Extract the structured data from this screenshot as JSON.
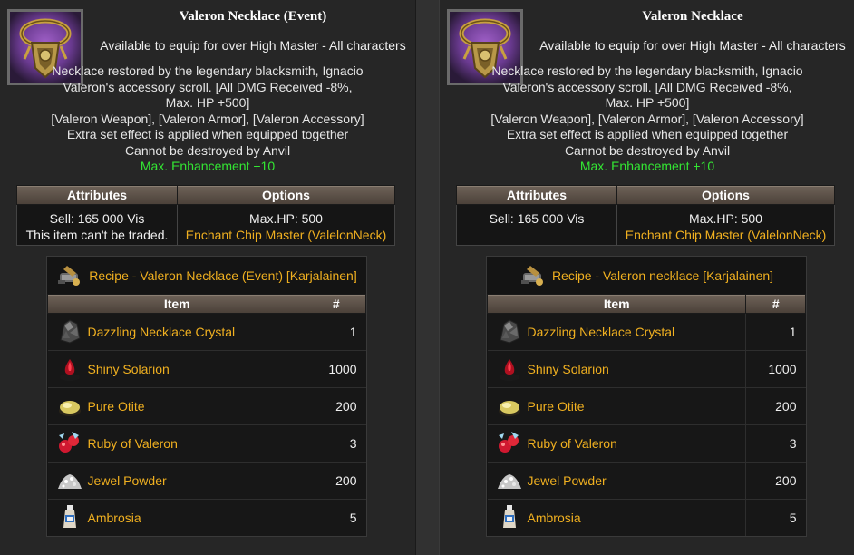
{
  "panels": [
    {
      "title": "Valeron Necklace (Event)",
      "equip": "Available to equip for over High Master - All characters",
      "description": [
        "Necklace restored by the legendary blacksmith, Ignacio",
        "Valeron's accessory scroll. [All DMG Received -8%,",
        "Max. HP +500]",
        "[Valeron Weapon], [Valeron Armor], [Valeron Accessory]",
        "Extra set effect is applied when equipped together",
        "Cannot be destroyed by Anvil"
      ],
      "enhancement": "Max. Enhancement +10",
      "attributes_header": "Attributes",
      "options_header": "Options",
      "sell": "Sell: 165 000 Vis",
      "trade": "This item can't be traded.",
      "option_hp": "Max.HP: 500",
      "enchant": "Enchant Chip Master (ValelonNeck)",
      "recipe_title": "Recipe - Valeron Necklace (Event) [Karjalainen]",
      "item_header": "Item",
      "qty_header": "#",
      "materials": [
        {
          "name": "Dazzling Necklace Crystal",
          "qty": "1",
          "icon": "crystal-icon"
        },
        {
          "name": "Shiny Solarion",
          "qty": "1000",
          "icon": "solarion-icon"
        },
        {
          "name": "Pure Otite",
          "qty": "200",
          "icon": "otite-icon"
        },
        {
          "name": "Ruby of Valeron",
          "qty": "3",
          "icon": "ruby-icon"
        },
        {
          "name": "Jewel Powder",
          "qty": "200",
          "icon": "powder-icon"
        },
        {
          "name": "Ambrosia",
          "qty": "5",
          "icon": "ambrosia-icon"
        }
      ]
    },
    {
      "title": "Valeron Necklace",
      "equip": "Available to equip for over High Master - All characters",
      "description": [
        "Necklace restored by the legendary blacksmith, Ignacio",
        "Valeron's accessory scroll. [All DMG Received -8%,",
        "Max. HP +500]",
        "[Valeron Weapon], [Valeron Armor], [Valeron Accessory]",
        "Extra set effect is applied when equipped together",
        "Cannot be destroyed by Anvil"
      ],
      "enhancement": "Max. Enhancement +10",
      "attributes_header": "Attributes",
      "options_header": "Options",
      "sell": "Sell: 165 000 Vis",
      "trade": "",
      "option_hp": "Max.HP: 500",
      "enchant": "Enchant Chip Master (ValelonNeck)",
      "recipe_title": "Recipe - Valeron necklace [Karjalainen]",
      "item_header": "Item",
      "qty_header": "#",
      "materials": [
        {
          "name": "Dazzling Necklace Crystal",
          "qty": "1",
          "icon": "crystal-icon"
        },
        {
          "name": "Shiny Solarion",
          "qty": "1000",
          "icon": "solarion-icon"
        },
        {
          "name": "Pure Otite",
          "qty": "200",
          "icon": "otite-icon"
        },
        {
          "name": "Ruby of Valeron",
          "qty": "3",
          "icon": "ruby-icon"
        },
        {
          "name": "Jewel Powder",
          "qty": "200",
          "icon": "powder-icon"
        },
        {
          "name": "Ambrosia",
          "qty": "5",
          "icon": "ambrosia-icon"
        }
      ]
    }
  ],
  "colors": {
    "gold": "#f0b020",
    "green": "#33e633",
    "header": "#5c5048"
  }
}
